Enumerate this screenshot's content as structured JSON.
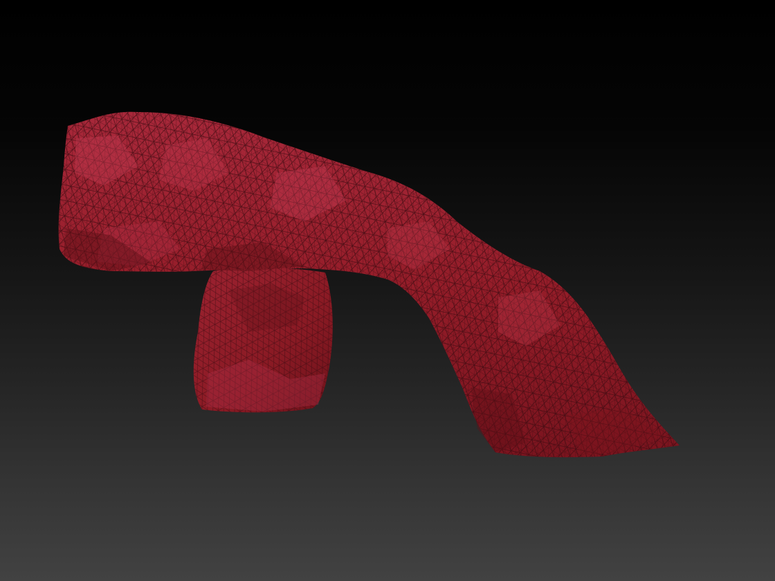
{
  "viewport": {
    "background_top": "#000000",
    "background_bottom": "#424242"
  },
  "model": {
    "description_icon": "rock-arch-mesh",
    "material_base": "#9a1f28",
    "material_dark": "#6e1219",
    "material_highlight": "#c23a4f",
    "wire_color": "#3a0a10",
    "wireframe": true
  }
}
